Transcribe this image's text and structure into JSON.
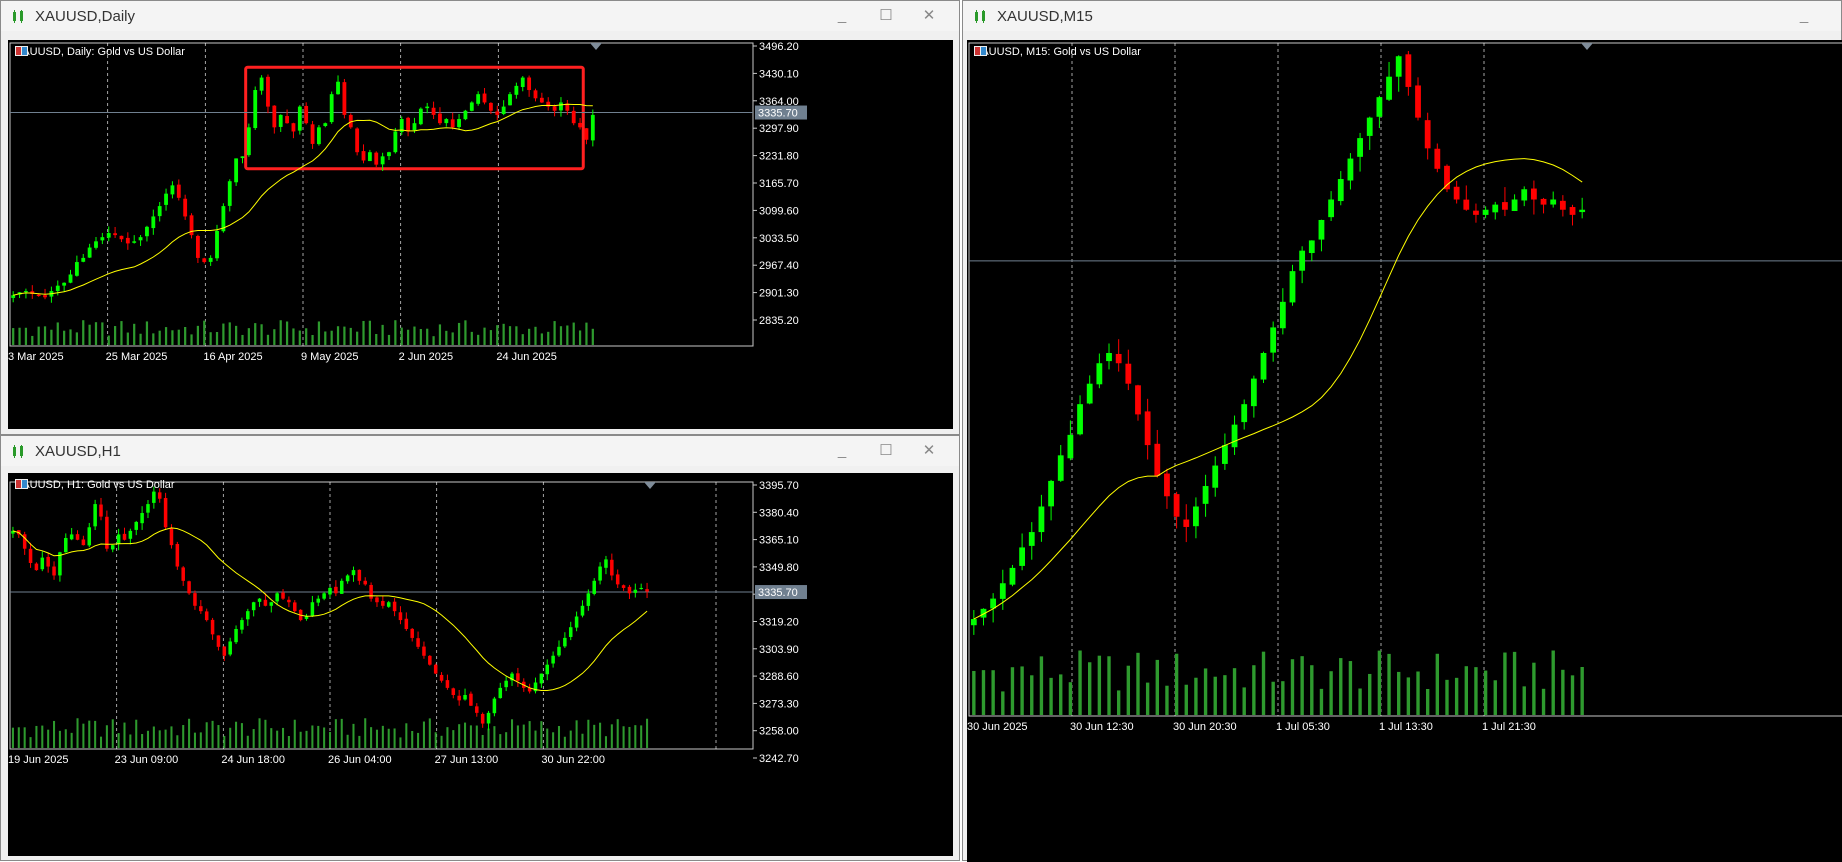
{
  "windows": {
    "daily": {
      "title": "XAUUSD,Daily",
      "label": "XAUUSD, Daily:  Gold vs US Dollar",
      "current_price": "3335.70"
    },
    "h1": {
      "title": "XAUUSD,H1",
      "label": "XAUUSD, H1:  Gold vs US Dollar",
      "current_price": "3335.70"
    },
    "m15": {
      "title": "XAUUSD,M15",
      "label": "XAUUSD, M15:  Gold vs US Dollar"
    }
  },
  "window_controls": {
    "minimize": "_",
    "maximize": "☐",
    "close": "✕"
  },
  "colors": {
    "bull": "#00ff00",
    "bear": "#ff0000",
    "ma": "#ffff00",
    "volume": "#2e9a2e",
    "grid": "#ffffff",
    "price_line": "#708090",
    "box": "#ff2020"
  },
  "chart_data": [
    {
      "name": "XAUUSD Daily",
      "type": "candlestick",
      "y_ticks": [
        "3496.20",
        "3430.10",
        "3364.00",
        "3297.90",
        "3231.80",
        "3165.70",
        "3099.60",
        "3033.50",
        "2967.40",
        "2901.30",
        "2835.20"
      ],
      "x_ticks": [
        "3 Mar 2025",
        "25 Mar 2025",
        "16 Apr 2025",
        "9 May 2025",
        "2 Jun 2025",
        "24 Jun 2025"
      ],
      "ylim": [
        2835.2,
        3496.2
      ],
      "moving_average": true,
      "annotation": "red rectangle around consolidation range Apr–Jun 2025",
      "box_range": [
        3200,
        3445
      ],
      "closes": [
        2895,
        2902,
        2905,
        2898,
        2893,
        2890,
        2905,
        2918,
        2925,
        2945,
        2975,
        2985,
        3010,
        3025,
        3035,
        3045,
        3040,
        3030,
        3020,
        3025,
        3035,
        3060,
        3085,
        3110,
        3140,
        3160,
        3130,
        3085,
        3040,
        2985,
        2975,
        2985,
        3050,
        3110,
        3170,
        3225,
        3230,
        3300,
        3390,
        3420,
        3350,
        3300,
        3330,
        3310,
        3290,
        3350,
        3310,
        3260,
        3300,
        3310,
        3380,
        3410,
        3330,
        3300,
        3240,
        3220,
        3240,
        3210,
        3230,
        3240,
        3290,
        3320,
        3290,
        3310,
        3345,
        3350,
        3330,
        3310,
        3320,
        3300,
        3320,
        3340,
        3360,
        3380,
        3360,
        3340,
        3330,
        3350,
        3380,
        3400,
        3420,
        3390,
        3370,
        3360,
        3350,
        3340,
        3360,
        3340,
        3310,
        3300,
        3270,
        3330
      ],
      "current_price": 3335.7
    },
    {
      "name": "XAUUSD H1",
      "type": "candlestick",
      "y_ticks": [
        "3395.70",
        "3380.40",
        "3365.10",
        "3349.80",
        "3334.50",
        "3319.20",
        "3303.90",
        "3288.60",
        "3273.30",
        "3258.00",
        "3242.70"
      ],
      "x_ticks": [
        "19 Jun 2025",
        "23 Jun 09:00",
        "24 Jun 18:00",
        "26 Jun 04:00",
        "27 Jun 13:00",
        "30 Jun 22:00"
      ],
      "ylim": [
        3242.7,
        3395.7
      ],
      "moving_average": true,
      "closes": [
        3370,
        3368,
        3360,
        3352,
        3348,
        3355,
        3350,
        3345,
        3358,
        3366,
        3368,
        3365,
        3362,
        3372,
        3385,
        3378,
        3360,
        3362,
        3368,
        3365,
        3370,
        3375,
        3380,
        3385,
        3392,
        3388,
        3372,
        3362,
        3350,
        3342,
        3335,
        3328,
        3325,
        3320,
        3312,
        3305,
        3300,
        3308,
        3315,
        3320,
        3325,
        3330,
        3332,
        3328,
        3330,
        3335,
        3332,
        3330,
        3325,
        3320,
        3322,
        3330,
        3332,
        3335,
        3338,
        3335,
        3342,
        3345,
        3348,
        3342,
        3340,
        3332,
        3330,
        3328,
        3330,
        3325,
        3320,
        3315,
        3310,
        3305,
        3300,
        3295,
        3290,
        3286,
        3282,
        3278,
        3275,
        3278,
        3272,
        3268,
        3262,
        3268,
        3276,
        3282,
        3286,
        3290,
        3286,
        3282,
        3280,
        3285,
        3290,
        3295,
        3300,
        3305,
        3310,
        3316,
        3322,
        3328,
        3335,
        3342,
        3350,
        3354,
        3345,
        3340,
        3338,
        3335,
        3337,
        3338,
        3336
      ],
      "current_price": 3335.7
    },
    {
      "name": "XAUUSD M15",
      "type": "candlestick",
      "x_ticks": [
        "30 Jun 2025",
        "30 Jun 12:30",
        "30 Jun 20:30",
        "1 Jul 05:30",
        "1 Jul 13:30",
        "1 Jul 21:30"
      ],
      "ylim": [
        3240,
        3360
      ],
      "moving_average": true,
      "closes": [
        3248,
        3250,
        3252,
        3255,
        3258,
        3262,
        3265,
        3270,
        3275,
        3280,
        3284,
        3290,
        3294,
        3298,
        3300,
        3298,
        3294,
        3288,
        3282,
        3276,
        3272,
        3268,
        3266,
        3270,
        3274,
        3278,
        3282,
        3286,
        3290,
        3295,
        3300,
        3305,
        3310,
        3316,
        3320,
        3322,
        3326,
        3330,
        3334,
        3338,
        3342,
        3346,
        3350,
        3354,
        3358,
        3352,
        3346,
        3340,
        3336,
        3332,
        3330,
        3328,
        3327,
        3328,
        3329,
        3328,
        3330,
        3332,
        3330,
        3329,
        3330,
        3328,
        3327,
        3328
      ],
      "current_price": 3318
    }
  ]
}
